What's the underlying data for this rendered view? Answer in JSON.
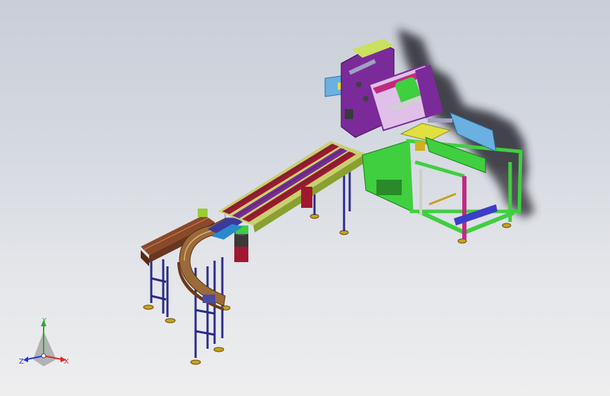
{
  "viewport": {
    "background_top": "#c9ced8",
    "background_bottom": "#eeeeef"
  },
  "triad": {
    "x_label": "X",
    "y_label": "Y",
    "z_label": "Z",
    "x_color": "#e0262b",
    "y_color": "#22aa33",
    "z_color": "#2233dd"
  },
  "palette": {
    "frame_purple": "#7b2a9a",
    "frame_green": "#3fcf3f",
    "frame_blue": "#3a3fc8",
    "conveyor_brown": "#8a4a2a",
    "conveyor_red": "#a01830",
    "lime": "#b8e040",
    "shadow": "#2a2a2e"
  }
}
